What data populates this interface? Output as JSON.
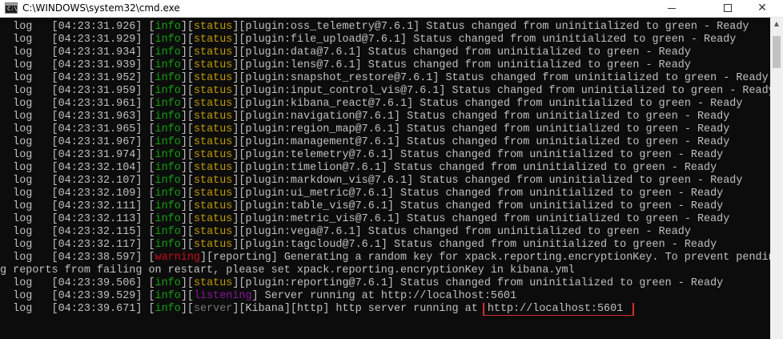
{
  "window": {
    "title": "C:\\WINDOWS\\system32\\cmd.exe",
    "icon_text": "C:\\."
  },
  "controls": {
    "close_glyph": "✕"
  },
  "console_lines": [
    {
      "prefix": "  log   [04:23:31.926] ",
      "t1": "info",
      "t2": "status",
      "t3": "",
      "rest": "[plugin:oss_telemetry@7.6.1] Status changed from uninitialized to green - Ready"
    },
    {
      "prefix": "  log   [04:23:31.929] ",
      "t1": "info",
      "t2": "status",
      "t3": "",
      "rest": "[plugin:file_upload@7.6.1] Status changed from uninitialized to green - Ready"
    },
    {
      "prefix": "  log   [04:23:31.934] ",
      "t1": "info",
      "t2": "status",
      "t3": "",
      "rest": "[plugin:data@7.6.1] Status changed from uninitialized to green - Ready"
    },
    {
      "prefix": "  log   [04:23:31.939] ",
      "t1": "info",
      "t2": "status",
      "t3": "",
      "rest": "[plugin:lens@7.6.1] Status changed from uninitialized to green - Ready"
    },
    {
      "prefix": "  log   [04:23:31.952] ",
      "t1": "info",
      "t2": "status",
      "t3": "",
      "rest": "[plugin:snapshot_restore@7.6.1] Status changed from uninitialized to green - Ready"
    },
    {
      "prefix": "  log   [04:23:31.959] ",
      "t1": "info",
      "t2": "status",
      "t3": "",
      "rest": "[plugin:input_control_vis@7.6.1] Status changed from uninitialized to green - Ready"
    },
    {
      "prefix": "  log   [04:23:31.961] ",
      "t1": "info",
      "t2": "status",
      "t3": "",
      "rest": "[plugin:kibana_react@7.6.1] Status changed from uninitialized to green - Ready"
    },
    {
      "prefix": "  log   [04:23:31.963] ",
      "t1": "info",
      "t2": "status",
      "t3": "",
      "rest": "[plugin:navigation@7.6.1] Status changed from uninitialized to green - Ready"
    },
    {
      "prefix": "  log   [04:23:31.965] ",
      "t1": "info",
      "t2": "status",
      "t3": "",
      "rest": "[plugin:region_map@7.6.1] Status changed from uninitialized to green - Ready"
    },
    {
      "prefix": "  log   [04:23:31.967] ",
      "t1": "info",
      "t2": "status",
      "t3": "",
      "rest": "[plugin:management@7.6.1] Status changed from uninitialized to green - Ready"
    },
    {
      "prefix": "  log   [04:23:31.974] ",
      "t1": "info",
      "t2": "status",
      "t3": "",
      "rest": "[plugin:telemetry@7.6.1] Status changed from uninitialized to green - Ready"
    },
    {
      "prefix": "  log   [04:23:32.104] ",
      "t1": "info",
      "t2": "status",
      "t3": "",
      "rest": "[plugin:timelion@7.6.1] Status changed from uninitialized to green - Ready"
    },
    {
      "prefix": "  log   [04:23:32.107] ",
      "t1": "info",
      "t2": "status",
      "t3": "",
      "rest": "[plugin:markdown_vis@7.6.1] Status changed from uninitialized to green - Ready"
    },
    {
      "prefix": "  log   [04:23:32.109] ",
      "t1": "info",
      "t2": "status",
      "t3": "",
      "rest": "[plugin:ui_metric@7.6.1] Status changed from uninitialized to green - Ready"
    },
    {
      "prefix": "  log   [04:23:32.111] ",
      "t1": "info",
      "t2": "status",
      "t3": "",
      "rest": "[plugin:table_vis@7.6.1] Status changed from uninitialized to green - Ready"
    },
    {
      "prefix": "  log   [04:23:32.113] ",
      "t1": "info",
      "t2": "status",
      "t3": "",
      "rest": "[plugin:metric_vis@7.6.1] Status changed from uninitialized to green - Ready"
    },
    {
      "prefix": "  log   [04:23:32.115] ",
      "t1": "info",
      "t2": "status",
      "t3": "",
      "rest": "[plugin:vega@7.6.1] Status changed from uninitialized to green - Ready"
    },
    {
      "prefix": "  log   [04:23:32.117] ",
      "t1": "info",
      "t2": "status",
      "t3": "",
      "rest": "[plugin:tagcloud@7.6.1] Status changed from uninitialized to green - Ready"
    },
    {
      "prefix": "  log   [04:23:38.597] ",
      "t1": "",
      "t2": "",
      "t3": "warning",
      "rest": "[reporting] Generating a random key for xpack.reporting.encryptionKey. To prevent pendin"
    },
    {
      "prefix": "g reports from failing on restart, please set xpack.reporting.encryptionKey in kibana.yml",
      "t1": "",
      "t2": "",
      "t3": "",
      "rest": ""
    },
    {
      "prefix": "  log   [04:23:39.506] ",
      "t1": "info",
      "t2": "status",
      "t3": "",
      "rest": "[plugin:reporting@7.6.1] Status changed from uninitialized to green - Ready"
    }
  ],
  "listening_line": {
    "prefix": "  log   [04:23:39.529] ",
    "tag_info": "info",
    "tag_listening": "listening",
    "rest": " Server running at http://localhost:5601"
  },
  "server_line": {
    "prefix": "  log   [04:23:39.671] ",
    "tag_info": "info",
    "tag_server": "server",
    "rest": "[Kibana][http] http server running at ",
    "url": "http://localhost:5601"
  },
  "colors": {
    "background": "#0c0c0c",
    "text": "#c0c0c0",
    "info": "#13a10e",
    "status": "#c19c00",
    "warning": "#c50f1f",
    "listening": "#881798",
    "server": "#767676",
    "highlight": "#d32f2f"
  }
}
